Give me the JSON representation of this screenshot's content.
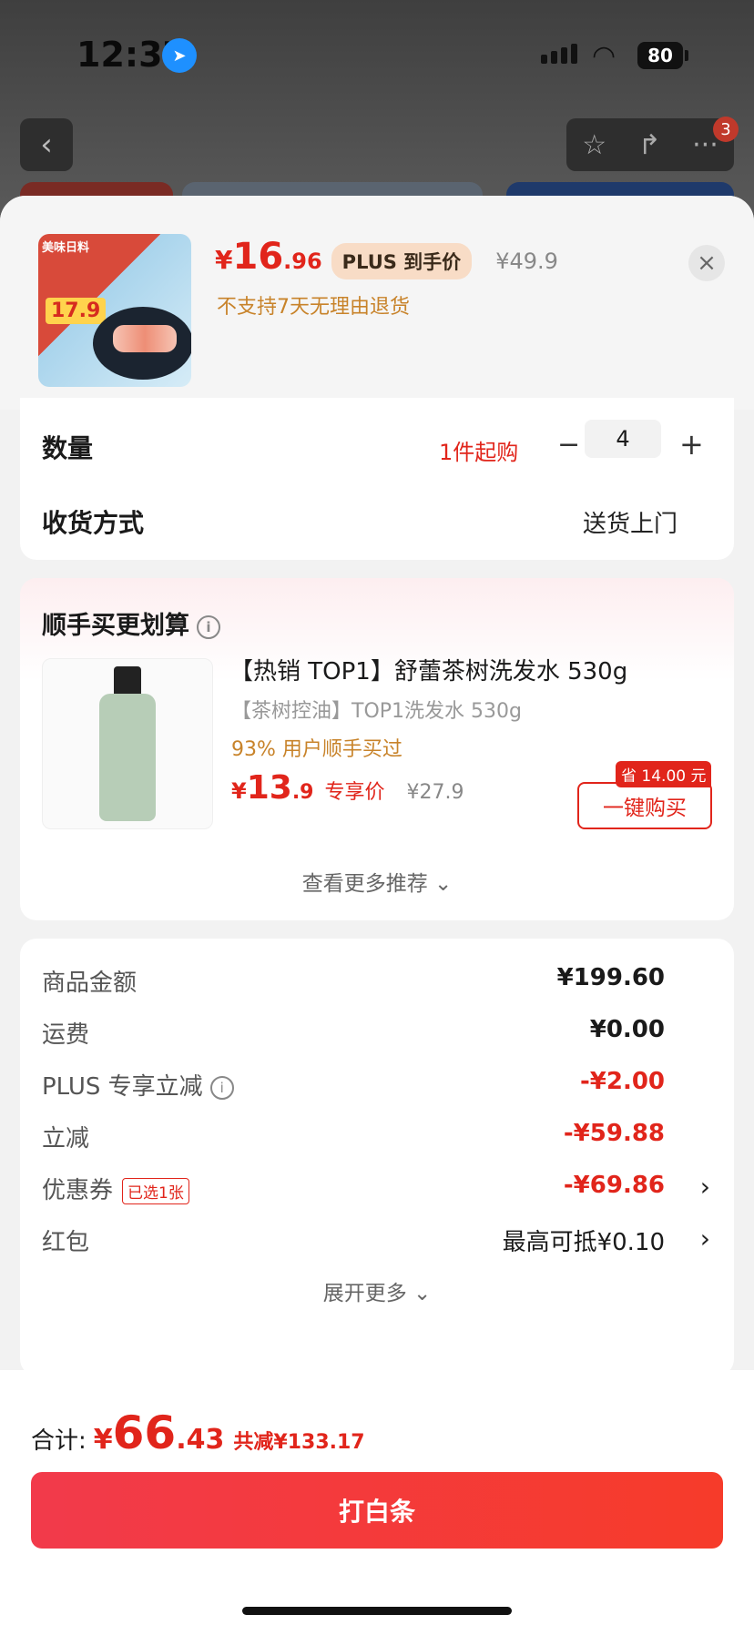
{
  "status_bar": {
    "time": "12:37",
    "battery": "80"
  },
  "nav": {
    "badge_count": "3"
  },
  "product": {
    "thumb_tag": "美味日料",
    "thumb_price": "17.9",
    "price_symbol": "¥",
    "price_int": "16",
    "price_dec": ".96",
    "plus_label": "PLUS 到手价",
    "original_price": "¥49.9",
    "return_notice": "不支持7天无理由退货"
  },
  "quantity": {
    "label": "数量",
    "min_notice": "1件起购",
    "minus": "−",
    "value": "4",
    "plus": "+"
  },
  "delivery": {
    "label": "收货方式",
    "value": "送货上门"
  },
  "recommend": {
    "title": "顺手买更划算",
    "item_title": "【热销 TOP1】舒蕾茶树洗发水 530g",
    "item_sub": "【茶树控油】TOP1洗发水 530g",
    "bought_text": "93% 用户顺手买过",
    "price_symbol": "¥",
    "price_int": "13",
    "price_dec": ".9",
    "price_label": "专享价",
    "original_price": "¥27.9",
    "save_tag": "省 14.00 元",
    "buy_button": "一键购买",
    "more_link": "查看更多推荐"
  },
  "fees": [
    {
      "label": "商品金额",
      "value": "¥199.60"
    },
    {
      "label": "运费",
      "value": "¥0.00"
    },
    {
      "label": "PLUS 专享立减",
      "value": "-¥2.00"
    },
    {
      "label": "立减",
      "value": "-¥59.88"
    },
    {
      "label": "优惠券",
      "value": "-¥69.86",
      "tag": "已选1张"
    },
    {
      "label": "红包",
      "value": "最高可抵¥0.10"
    }
  ],
  "expand_more": "展开更多",
  "footer": {
    "total_label": "合计:",
    "total_symbol": "¥",
    "total_int": "66",
    "total_dec": ".43",
    "total_saved": "共减¥133.17",
    "pay_button": "打白条"
  },
  "colors": {
    "accent": "#e1251b",
    "warning": "#c8832a",
    "sheet_bg": "#f2f2f2"
  },
  "icons": [
    "location-arrow-icon",
    "signal-icon",
    "wifi-icon",
    "battery-icon",
    "back-arrow-icon",
    "star-icon",
    "share-icon",
    "more-icon",
    "close-icon",
    "info-icon",
    "chevron-down-icon",
    "chevron-right-icon"
  ]
}
